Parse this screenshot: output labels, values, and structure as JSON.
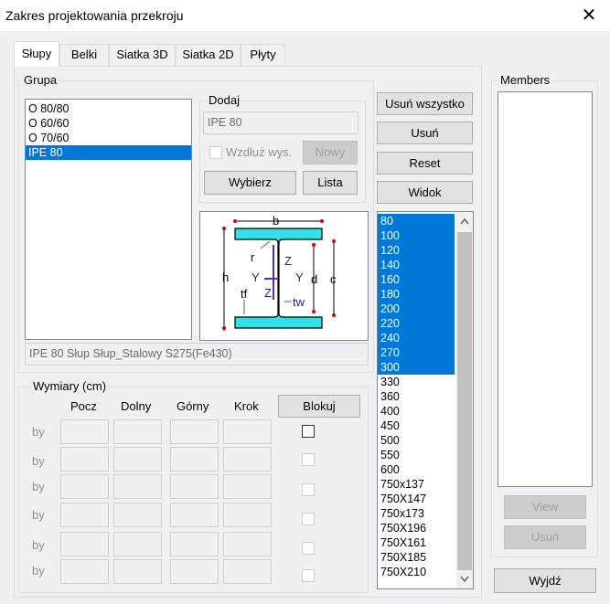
{
  "window": {
    "title": "Zakres projektowania przekroju",
    "close_glyph": "✕"
  },
  "tabs": [
    {
      "label": "Słupy",
      "active": true
    },
    {
      "label": "Belki"
    },
    {
      "label": "Siatka 3D"
    },
    {
      "label": "Siatka 2D"
    },
    {
      "label": "Płyty"
    }
  ],
  "grupa": {
    "legend": "Grupa",
    "items": [
      "O 80/80",
      "O 60/60",
      "O 70/60",
      "IPE 80"
    ],
    "selected": "IPE 80",
    "description": "IPE 80 Słup Słup_Stalowy S275(Fe430)"
  },
  "dodaj": {
    "legend": "Dodaj",
    "value": "IPE 80",
    "checkbox_label": "Wzdłuż wys.",
    "nowy": "Nowy",
    "wybierz": "Wybierz",
    "lista": "Lista"
  },
  "actions": {
    "usun_wszystko": "Usuń wszystko",
    "usun": "Usuń",
    "reset": "Reset",
    "widok": "Widok"
  },
  "profile_labels": {
    "b": "b",
    "h": "h",
    "r": "r",
    "z_top": "Z",
    "y_left": "Y",
    "y_right": "Y",
    "d": "d",
    "c": "c",
    "tf": "tf",
    "z_bottom": "Z",
    "tw": "tw"
  },
  "sizes": {
    "items": [
      "80",
      "100",
      "120",
      "140",
      "160",
      "180",
      "200",
      "220",
      "240",
      "270",
      "300",
      "330",
      "360",
      "400",
      "450",
      "500",
      "550",
      "600",
      "750x137",
      "750X147",
      "750x173",
      "750X196",
      "750X161",
      "750X185",
      "750X210"
    ],
    "selected_count": 11
  },
  "wymiary": {
    "legend": "Wymiary (cm)",
    "headers": [
      "Pocz",
      "Dolny",
      "Górny",
      "Krok"
    ],
    "blokuj": "Blokuj",
    "row_labels": [
      "by",
      "by",
      "by",
      "by",
      "by",
      "by"
    ]
  },
  "members": {
    "legend": "Members",
    "view": "View",
    "usun": "Usuń"
  },
  "wyjdz": "Wyjdź"
}
